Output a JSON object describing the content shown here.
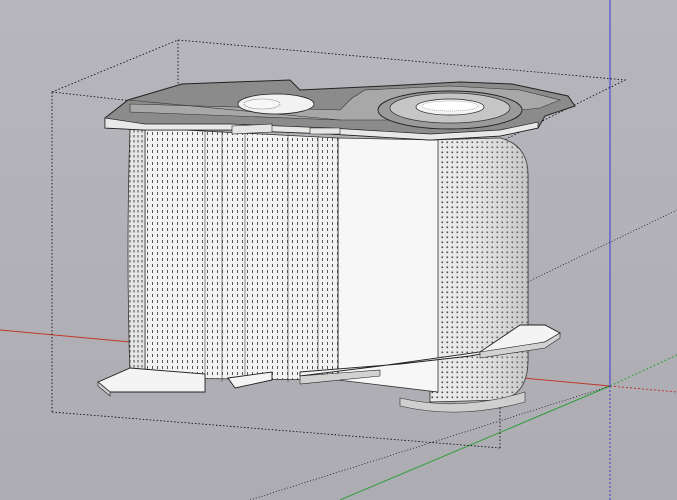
{
  "viewport": {
    "background": "#b3b3b9",
    "axis_colors": {
      "red_axis": "#c0392b",
      "green_axis": "#2f9e3a",
      "blue_axis": "#3a3ad0"
    },
    "model_face_color": "#f4f4f4",
    "model_shade_color": "#d8d8d8",
    "top_plate_color": "#8a8a8a",
    "bounding_box_style": "dotted"
  },
  "model": {
    "name": "",
    "components": [
      "top-plate",
      "cylinder-body",
      "flat-panel",
      "base-plate",
      "rings"
    ]
  }
}
